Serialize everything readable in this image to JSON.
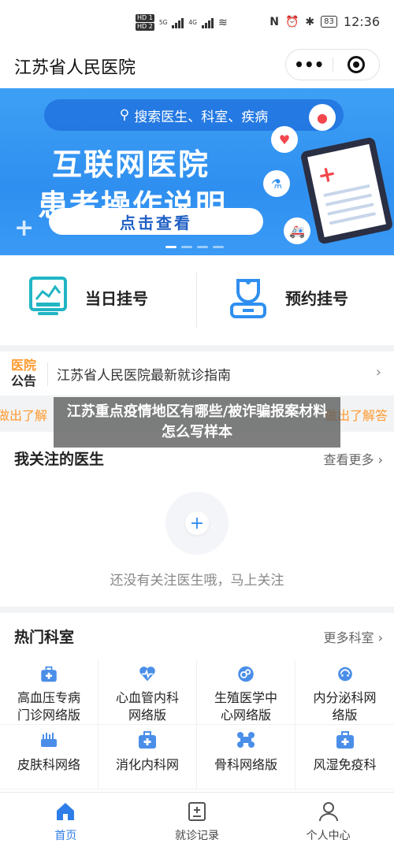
{
  "status_bar": {
    "hd1": "HD 1",
    "hd2": "HD 2",
    "net1": "5G",
    "net2": "4G",
    "time": "12:36",
    "battery": "83"
  },
  "header": {
    "title": "江苏省人民医院",
    "more_label": "•••"
  },
  "banner": {
    "search_placeholder": "搜索医生、科室、疾病",
    "headline1": "互联网医院",
    "headline2": "患者操作说明",
    "cta": "点击查看"
  },
  "quick_actions": [
    {
      "label": "当日挂号",
      "icon": "monitor-chart-icon"
    },
    {
      "label": "预约挂号",
      "icon": "nurse-icon"
    }
  ],
  "notice": {
    "tag_line1": "医院",
    "tag_line2": "公告",
    "text": "江苏省人民医院最新就诊指南"
  },
  "marquee": {
    "left": "做出了解",
    "right": "做出了解答"
  },
  "overlay_caption": "江苏重点疫情地区有哪些/被诈骗报案材料怎么写样本",
  "doctors": {
    "title": "我关注的医生",
    "more": "查看更多",
    "empty_tip": "还没有关注医生哦，马上关注"
  },
  "departments": {
    "title": "热门科室",
    "more": "更多科室",
    "items": [
      {
        "label": "高血压专病\n门诊网络版",
        "icon": "medkit-icon"
      },
      {
        "label": "心血管内科\n网络版",
        "icon": "heartbeat-icon"
      },
      {
        "label": "生殖医学中\n心网络版",
        "icon": "reproductive-icon"
      },
      {
        "label": "内分泌科网\n络版",
        "icon": "endocrine-icon"
      },
      {
        "label": "皮肤科网络",
        "icon": "skin-icon"
      },
      {
        "label": "消化内科网",
        "icon": "digestive-icon"
      },
      {
        "label": "骨科网络版",
        "icon": "bone-icon"
      },
      {
        "label": "风湿免疫科",
        "icon": "medkit-icon"
      }
    ]
  },
  "tabbar": [
    {
      "label": "首页",
      "active": true
    },
    {
      "label": "就诊记录",
      "active": false
    },
    {
      "label": "个人中心",
      "active": false
    }
  ],
  "colors": {
    "primary": "#2f8ff0",
    "accent": "#ff9a2f"
  }
}
